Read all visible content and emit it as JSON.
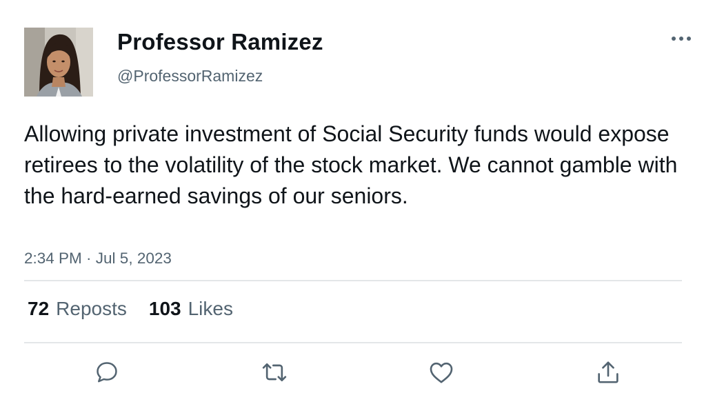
{
  "author": {
    "display_name": "Professor Ramizez",
    "handle": "@ProfessorRamizez"
  },
  "tweet": {
    "text": "Allowing private investment of Social Security funds would expose retirees to the volatility of the stock market. We cannot gamble with the hard-earned savings of our seniors.",
    "timestamp": "2:34 PM · Jul 5, 2023"
  },
  "stats": {
    "reposts_count": "72",
    "reposts_label": "Reposts",
    "likes_count": "103",
    "likes_label": "Likes"
  },
  "icons": {
    "more": "more-horizontal-icon",
    "reply": "reply-icon",
    "repost": "repost-icon",
    "like": "heart-icon",
    "share": "share-icon"
  },
  "colors": {
    "text_primary": "#0f1419",
    "text_secondary": "#536471",
    "icon": "#536471",
    "divider": "#e3e6e8"
  }
}
